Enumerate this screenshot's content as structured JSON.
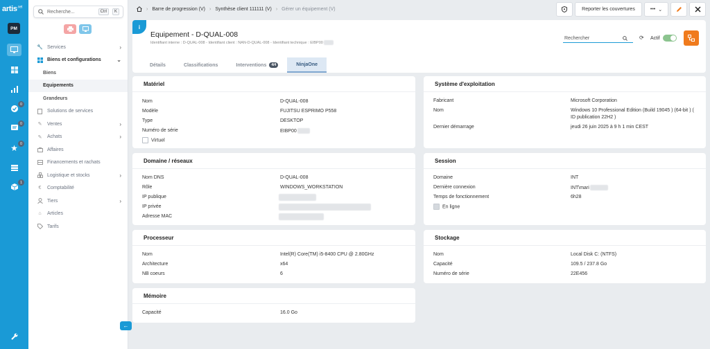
{
  "app": {
    "logo": "artis",
    "logo_suffix": ".net",
    "user_initials": "PM"
  },
  "rail": {
    "items": [
      {
        "name": "desktop-icon",
        "badge": ""
      },
      {
        "name": "grid-icon",
        "badge": ""
      },
      {
        "name": "chart-icon",
        "badge": ""
      },
      {
        "name": "check-icon",
        "badge": "0"
      },
      {
        "name": "chat-icon",
        "badge": "0"
      },
      {
        "name": "star-icon",
        "badge": "0"
      },
      {
        "name": "money-icon",
        "badge": ""
      },
      {
        "name": "box-icon",
        "badge": "1"
      }
    ],
    "bottom_icon": "wrench-icon"
  },
  "search": {
    "placeholder": "Recherche...",
    "key1": "Ctrl",
    "key2": "K"
  },
  "sidebar": {
    "items": [
      {
        "label": "Services",
        "chevron": "›",
        "bold": false
      },
      {
        "label": "Biens et configurations",
        "chevron": "⌄",
        "bold": true
      },
      {
        "label": "Biens",
        "sub": true
      },
      {
        "label": "Equipements",
        "sub": true,
        "active": true
      },
      {
        "label": "Grandeurs",
        "sub": true
      },
      {
        "label": "Solutions de services",
        "chevron": ""
      },
      {
        "label": "Ventes",
        "chevron": "›"
      },
      {
        "label": "Achats",
        "chevron": "›"
      },
      {
        "label": "Affaires",
        "chevron": ""
      },
      {
        "label": "Financements et rachats",
        "chevron": ""
      },
      {
        "label": "Logistique et stocks",
        "chevron": "›"
      },
      {
        "label": "Comptabilité",
        "chevron": ""
      },
      {
        "label": "Tiers",
        "chevron": "›"
      },
      {
        "label": "Articles",
        "chevron": ""
      },
      {
        "label": "Tarifs",
        "chevron": ""
      }
    ]
  },
  "breadcrumb": {
    "items": [
      "Barre de progression (V)",
      "Synthèse client 111111 (V)",
      "Gérer un équipement (V)"
    ]
  },
  "toolbar": {
    "report_label": "Reporter les couvertures",
    "more_label": "•••"
  },
  "header": {
    "title": "Equipement - D-QUAL-008",
    "subtitle": "Identifiant interne : D-QUAL-008 - Identifiant client : NAN-D-QUAL-008 - Identifiant technique : EIBP00",
    "search_placeholder": "Rechercher",
    "actif_label": "Actif",
    "tabs": [
      {
        "label": "Détails"
      },
      {
        "label": "Classifications"
      },
      {
        "label": "Interventions",
        "badge": "4/4"
      },
      {
        "label": "NinjaOne",
        "active": true
      }
    ]
  },
  "materiel": {
    "title": "Matériel",
    "rows": [
      {
        "label": "Nom",
        "value": "D-QUAL-008"
      },
      {
        "label": "Modèle",
        "value": "FUJITSU ESPRIMO P558"
      },
      {
        "label": "Type",
        "value": "DESKTOP"
      },
      {
        "label": "Numéro de série",
        "value": "EIBP00"
      }
    ],
    "virtuel_label": "Virtuel"
  },
  "domaine": {
    "title": "Domaine / réseaux",
    "rows": [
      {
        "label": "Nom DNS",
        "value": "D-QUAL-008"
      },
      {
        "label": "Rôle",
        "value": "WINDOWS_WORKSTATION"
      },
      {
        "label": "IP publique",
        "value": ""
      },
      {
        "label": "IP privée",
        "value": ""
      },
      {
        "label": "Adresse MAC",
        "value": ""
      }
    ]
  },
  "processeur": {
    "title": "Processeur",
    "rows": [
      {
        "label": "Nom",
        "value": "Intel(R) Core(TM) i5-8400 CPU @ 2.80GHz"
      },
      {
        "label": "Architecture",
        "value": "x64"
      },
      {
        "label": "NB coeurs",
        "value": "6"
      }
    ]
  },
  "memoire": {
    "title": "Mémoire",
    "rows": [
      {
        "label": "Capacité",
        "value": "16.0 Go"
      }
    ]
  },
  "os": {
    "title": "Système d'exploitation",
    "rows": [
      {
        "label": "Fabricant",
        "value": "Microsoft Corporation"
      },
      {
        "label": "Nom",
        "value": "Windows 10 Professional Edition (Build 19045 ) (64-bit ) ("
      },
      {
        "label": "",
        "value": "ID publication 22H2 )"
      },
      {
        "label": "Dernier démarrage",
        "value": "jeudi 26 juin 2025 à 9 h 1 min CEST"
      }
    ]
  },
  "session": {
    "title": "Session",
    "rows": [
      {
        "label": "Domaine",
        "value": "INT"
      },
      {
        "label": "Dernière connexion",
        "value": "INT\\mari"
      },
      {
        "label": "Temps de fonctionnement",
        "value": "6h28"
      }
    ],
    "online_label": "En ligne"
  },
  "stockage": {
    "title": "Stockage",
    "rows": [
      {
        "label": "Nom",
        "value": "Local Disk C: (NTFS)"
      },
      {
        "label": "Capacité",
        "value": "109.5 / 237.8 Go"
      },
      {
        "label": "Numéro de série",
        "value": "22E456"
      }
    ]
  },
  "colors": {
    "accent": "#1a9ad6",
    "orange": "#f07b1d",
    "toggle": "#8cc48f"
  }
}
